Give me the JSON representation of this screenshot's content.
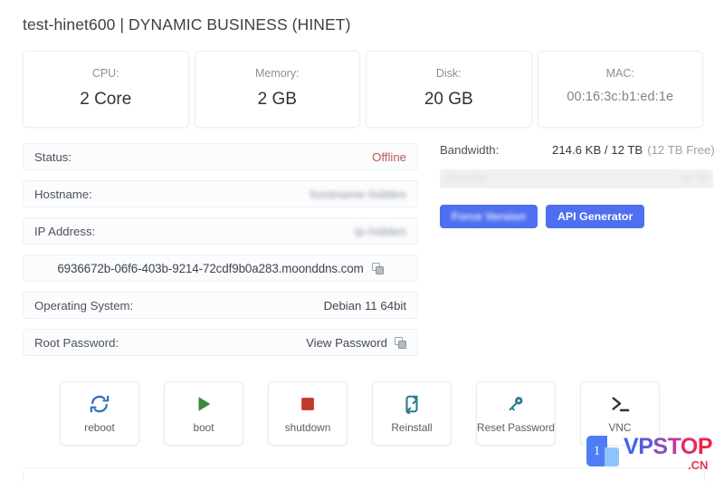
{
  "header": {
    "title": "test-hinet600 | DYNAMIC BUSINESS (HINET)"
  },
  "specs": [
    {
      "label": "CPU:",
      "value": "2 Core",
      "name": "cpu"
    },
    {
      "label": "Memory:",
      "value": "2 GB",
      "name": "memory"
    },
    {
      "label": "Disk:",
      "value": "20 GB",
      "name": "disk"
    },
    {
      "label": "MAC:",
      "value": "00:16:3c:b1:ed:1e",
      "name": "mac"
    }
  ],
  "info": {
    "status": {
      "label": "Status:",
      "value": "Offline"
    },
    "hostname": {
      "label": "Hostname:",
      "value": "hostname-hidden"
    },
    "ip_address": {
      "label": "IP Address:",
      "value": "ip-hidden"
    },
    "domain": {
      "value": "6936672b-06f6-403b-9214-72cdf9b0a283.moonddns.com"
    },
    "operating_system": {
      "label": "Operating System:",
      "value": "Debian 11 64bit"
    },
    "root_password": {
      "label": "Root Password:",
      "value": "View Password"
    }
  },
  "bandwidth": {
    "label": "Bandwidth:",
    "used_total": "214.6 KB / 12 TB",
    "free": "(12 TB Free)",
    "bar_left_text": "214.6 KB",
    "bar_right_text": "12 TB",
    "buttons": [
      {
        "label": "Force Version",
        "name": "force-version-button",
        "blurred": true
      },
      {
        "label": "API Generator",
        "name": "api-generator-button",
        "blurred": false
      }
    ]
  },
  "actions": [
    {
      "label": "reboot",
      "icon": "reboot-icon",
      "name": "reboot"
    },
    {
      "label": "boot",
      "icon": "play-icon",
      "name": "boot"
    },
    {
      "label": "shutdown",
      "icon": "stop-square-icon",
      "name": "shutdown"
    },
    {
      "label": "Reinstall",
      "icon": "reinstall-arrows-icon",
      "name": "reinstall"
    },
    {
      "label": "Reset Password",
      "icon": "key-icon",
      "name": "reset-password"
    },
    {
      "label": "VNC",
      "icon": "terminal-prompt-icon",
      "name": "vnc"
    }
  ],
  "watermark": {
    "logo_digit": "1",
    "brand": "VPSTOP",
    "tld": ".CN"
  },
  "colors": {
    "accent_blue": "#4f6ff0",
    "offline_red": "#bb5b57",
    "reboot_blue": "#2f6fbf",
    "boot_green": "#3a8a3a",
    "shutdown_red": "#c0392b",
    "teal": "#2b7c8f",
    "terminal_dark": "#2f3338"
  }
}
